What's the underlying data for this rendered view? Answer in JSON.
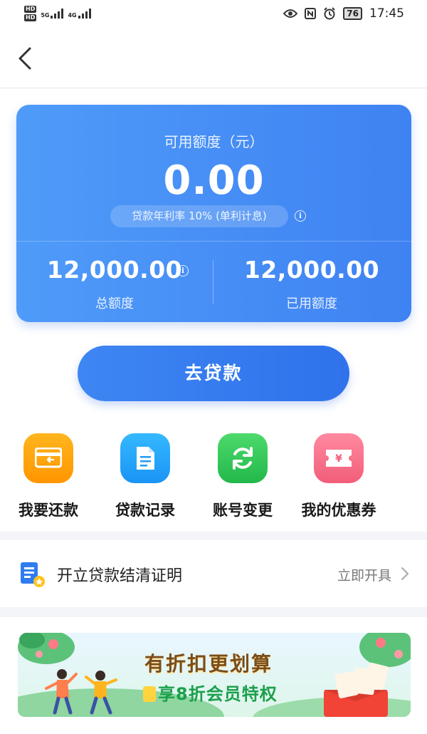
{
  "status_bar": {
    "hd1": "HD",
    "hd2": "HD",
    "net1": "5G",
    "net2": "4G",
    "battery": "76",
    "time": "17:45"
  },
  "nav": {
    "back_icon": "chevron-left-icon"
  },
  "card": {
    "available_label": "可用额度（元）",
    "available_amount": "0.00",
    "rate_text": "贷款年利率 10% (单利计息)",
    "total_value": "12,000.00",
    "total_label": "总额度",
    "used_value": "12,000.00",
    "used_label": "已用额度"
  },
  "loan_button": {
    "label": "去贷款"
  },
  "actions": [
    {
      "label": "我要还款",
      "icon": "card-return-icon",
      "color": "#ff9f0f"
    },
    {
      "label": "贷款记录",
      "icon": "document-icon",
      "color": "#1f9bf7"
    },
    {
      "label": "账号变更",
      "icon": "refresh-icon",
      "color": "#2cc052"
    },
    {
      "label": "我的优惠券",
      "icon": "coupon-icon",
      "color": "#f6677f"
    }
  ],
  "certificate": {
    "title": "开立贷款结清证明",
    "action": "立即开具",
    "icon": "certificate-icon"
  },
  "banner": {
    "title": "有折扣更划算",
    "subtitle": "享8折会员特权"
  },
  "colors": {
    "primary": "#3f82f2",
    "card_gradient_start": "#4f9bf9"
  }
}
